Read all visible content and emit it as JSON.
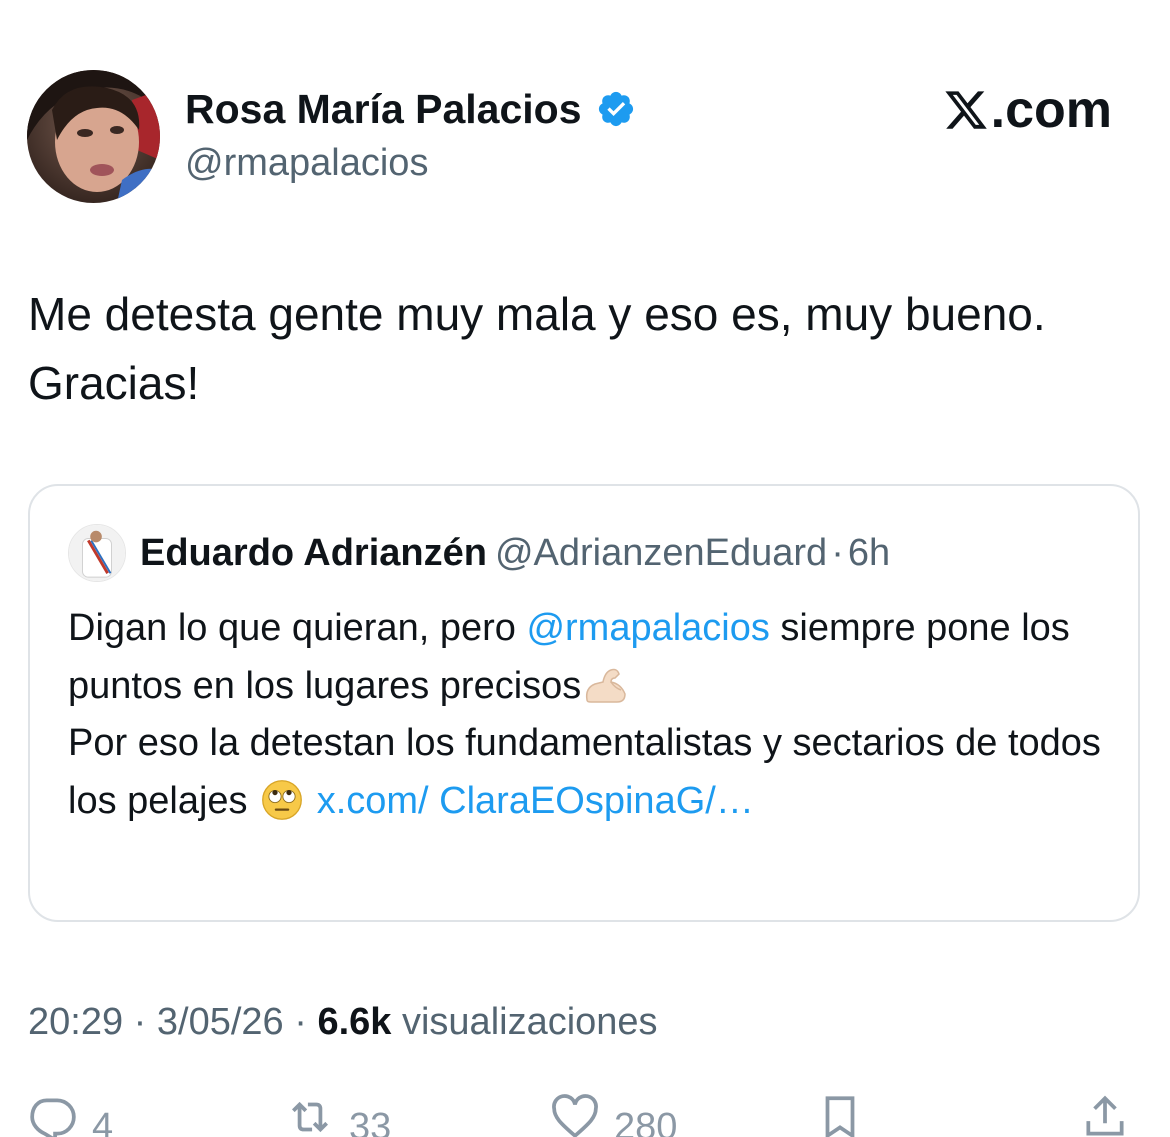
{
  "author": {
    "name": "Rosa María Palacios",
    "handle": "@rmapalacios",
    "verified": true,
    "avatar_icon": "profile-photo-icon"
  },
  "brand": {
    "text": ".com",
    "logo_icon": "x-logo-icon"
  },
  "tweet": {
    "line1": "Me detesta gente muy mala y eso es, muy bueno.",
    "line2": "Gracias!"
  },
  "quoted": {
    "name": "Eduardo Adrianzén",
    "handle": "@AdrianzenEduard",
    "separator": "·",
    "time": "6h",
    "text_part1": "Digan lo que quieran, pero ",
    "mention": "@rmapalacios",
    "text_part2": " siempre pone los puntos en los lugares precisos",
    "emoji1": "flexed-biceps-emoji",
    "text_part3": "Por eso la detestan los fundamentalistas y sectarios de todos los pelajes ",
    "emoji2": "face-with-rolling-eyes-emoji",
    "link_text": "x.com/ ClaraEOspinaG/…"
  },
  "meta": {
    "time": "20:29",
    "separator": " · ",
    "date": "3/05/26",
    "views_count": "6.6k",
    "views_label": " visualizaciones"
  },
  "actions": {
    "replies": "4",
    "retweets": "33",
    "likes": "280"
  },
  "colors": {
    "link": "#1d9bf0",
    "secondary_text": "#536471",
    "verified": "#1d9bf0",
    "border": "#dfe3e7"
  }
}
